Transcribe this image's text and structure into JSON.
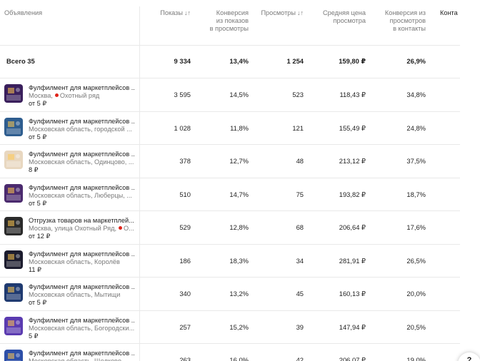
{
  "header": {
    "col_ads": "Объявления",
    "col_pokazy": "Показы",
    "col_konv1": "Конверсия\nиз показов\nв просмотры",
    "col_prosm": "Просмотры",
    "col_price": "Средняя цена\nпросмотра",
    "col_konv2": "Конверсия из\nпросмотров\nв контакты",
    "col_contacts": "Конта",
    "sort_glyph": "↓↑"
  },
  "total": {
    "label": "Всего 35",
    "pokazy": "9 334",
    "konv1": "13,4%",
    "prosm": "1 254",
    "price": "159,80 ₽",
    "konv2": "26,9%"
  },
  "rows": [
    {
      "title": "Фулфилмент для маркетплейсов ...",
      "addr": "Москва,",
      "metro": "Охотный ряд",
      "price_from": "от 5 ₽",
      "pokazy": "3 595",
      "konv1": "14,5%",
      "prosm": "523",
      "price": "118,43 ₽",
      "konv2": "34,8%"
    },
    {
      "title": "Фулфилмент для маркетплейсов ...",
      "addr": "Московская область, городской ...",
      "metro": "",
      "price_from": "от 5 ₽",
      "pokazy": "1 028",
      "konv1": "11,8%",
      "prosm": "121",
      "price": "155,49 ₽",
      "konv2": "24,8%"
    },
    {
      "title": "Фулфилмент для маркетплейсов ...",
      "addr": "Московская область, Одинцово, ...",
      "metro": "",
      "price_from": "8 ₽",
      "pokazy": "378",
      "konv1": "12,7%",
      "prosm": "48",
      "price": "213,12 ₽",
      "konv2": "37,5%"
    },
    {
      "title": "Фулфилмент для маркетплейсов ...",
      "addr": "Московская область, Люберцы, ...",
      "metro": "",
      "price_from": "от 5 ₽",
      "pokazy": "510",
      "konv1": "14,7%",
      "prosm": "75",
      "price": "193,82 ₽",
      "konv2": "18,7%"
    },
    {
      "title": "Отгрузка товаров на маркетплей...",
      "addr": "Москва, улица Охотный Ряд,",
      "metro": "О...",
      "price_from": "от 12 ₽",
      "pokazy": "529",
      "konv1": "12,8%",
      "prosm": "68",
      "price": "206,64 ₽",
      "konv2": "17,6%"
    },
    {
      "title": "Фулфилмент для маркетплейсов ...",
      "addr": "Московская область, Королёв",
      "metro": "",
      "price_from": "11 ₽",
      "pokazy": "186",
      "konv1": "18,3%",
      "prosm": "34",
      "price": "281,91 ₽",
      "konv2": "26,5%"
    },
    {
      "title": "Фулфилмент для маркетплейсов ...",
      "addr": "Московская область, Мытищи",
      "metro": "",
      "price_from": "от 5 ₽",
      "pokazy": "340",
      "konv1": "13,2%",
      "prosm": "45",
      "price": "160,13 ₽",
      "konv2": "20,0%"
    },
    {
      "title": "Фулфилмент для маркетплейсов ...",
      "addr": "Московская область, Богородски...",
      "metro": "",
      "price_from": "5 ₽",
      "pokazy": "257",
      "konv1": "15,2%",
      "prosm": "39",
      "price": "147,94 ₽",
      "konv2": "20,5%"
    },
    {
      "title": "Фулфилмент для маркетплейсов ...",
      "addr": "Московская область, Щелково",
      "metro": "",
      "price_from": "",
      "pokazy": "263",
      "konv1": "16,0%",
      "prosm": "42",
      "price": "206,07 ₽",
      "konv2": "19,0%"
    }
  ],
  "thumb_colors": [
    "#3a1f5c",
    "#2e5d8f",
    "#e8d7c0",
    "#4b2a6e",
    "#2a2a2a",
    "#1c1c2e",
    "#1f3a70",
    "#5b3bb0",
    "#2d4fa8"
  ],
  "float_button": "?"
}
